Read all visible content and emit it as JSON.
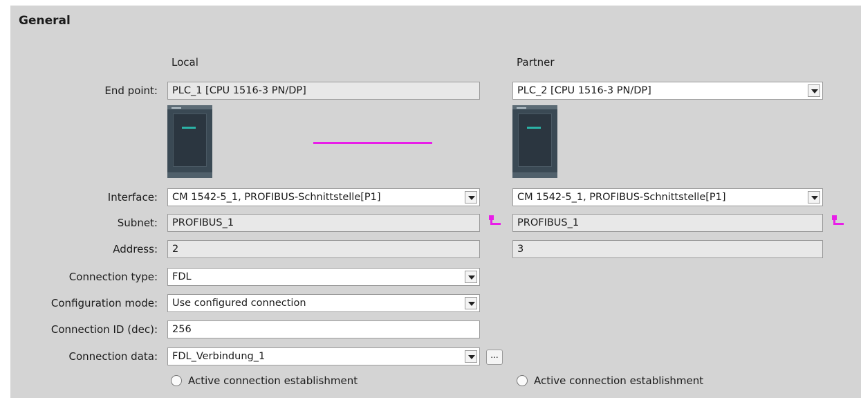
{
  "section": {
    "title": "General"
  },
  "columns": {
    "local": "Local",
    "partner": "Partner"
  },
  "labels": {
    "end_point": "End point:",
    "interface": "Interface:",
    "subnet": "Subnet:",
    "address": "Address:",
    "connection_type": "Connection type:",
    "configuration_mode": "Configuration mode:",
    "connection_id": "Connection ID (dec):",
    "connection_data": "Connection data:"
  },
  "local": {
    "end_point": "PLC_1 [CPU 1516-3 PN/DP]",
    "interface": "CM 1542-5_1, PROFIBUS-Schnittstelle[P1]",
    "subnet": "PROFIBUS_1",
    "address": "2",
    "active_connection_label": "Active connection establishment",
    "active_connection_selected": false
  },
  "partner": {
    "end_point": "PLC_2 [CPU 1516-3 PN/DP]",
    "interface": "CM 1542-5_1, PROFIBUS-Schnittstelle[P1]",
    "subnet": "PROFIBUS_1",
    "address": "3",
    "active_connection_label": "Active connection establishment",
    "active_connection_selected": false
  },
  "connection": {
    "type": "FDL",
    "configuration_mode": "Use configured connection",
    "id": "256",
    "data": "FDL_Verbindung_1",
    "browse_label": "..."
  },
  "colors": {
    "panel_bg": "#d4d4d4",
    "readonly_field": "#e8e8e8",
    "editable_field": "#ffffff",
    "connection_line": "#e81ee8",
    "subnet_icon": "#e81ee8"
  },
  "icons": {
    "local_device": "plc-cpu-icon",
    "partner_device": "plc-cpu-icon",
    "subnet": "profibus-subnet-icon",
    "dropdown": "chevron-down-icon"
  }
}
